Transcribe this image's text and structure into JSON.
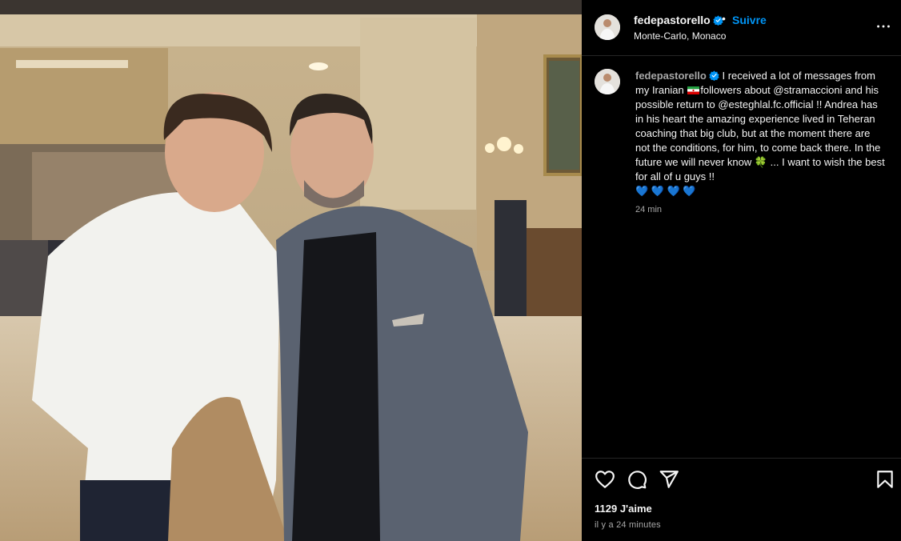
{
  "post": {
    "image_alt": "",
    "header": {
      "username": "fedepastorello",
      "separator": "•",
      "follow_label": "Suivre",
      "location": "Monte-Carlo, Monaco",
      "more_icon": "more-horizontal-icon"
    },
    "caption": {
      "username": "fedepastorello",
      "text_part1": "I received a lot of messages from my Iranian ",
      "text_part2": "followers about @stramaccioni and his possible return to @esteghlal.fc.official !! Andrea has in his heart the amazing experience lived in Teheran coaching that big club, but at the moment there are not the conditions, for him, to come back there. In the future we will never know ",
      "text_part3": " ... I want to wish the best for all of u guys !!",
      "hearts": "💙 💙 💙 💙",
      "clover": "🍀",
      "time": "24 min"
    },
    "actions": {
      "like_icon": "heart-icon",
      "comment_icon": "comment-icon",
      "share_icon": "send-icon",
      "save_icon": "bookmark-icon"
    },
    "likes_text": "1129 J'aime",
    "date_text": "il y a 24 minutes"
  },
  "colors": {
    "background": "#000000",
    "accent": "#0095f6",
    "verified": "#0095f6",
    "text_secondary": "#a8a8a8"
  }
}
